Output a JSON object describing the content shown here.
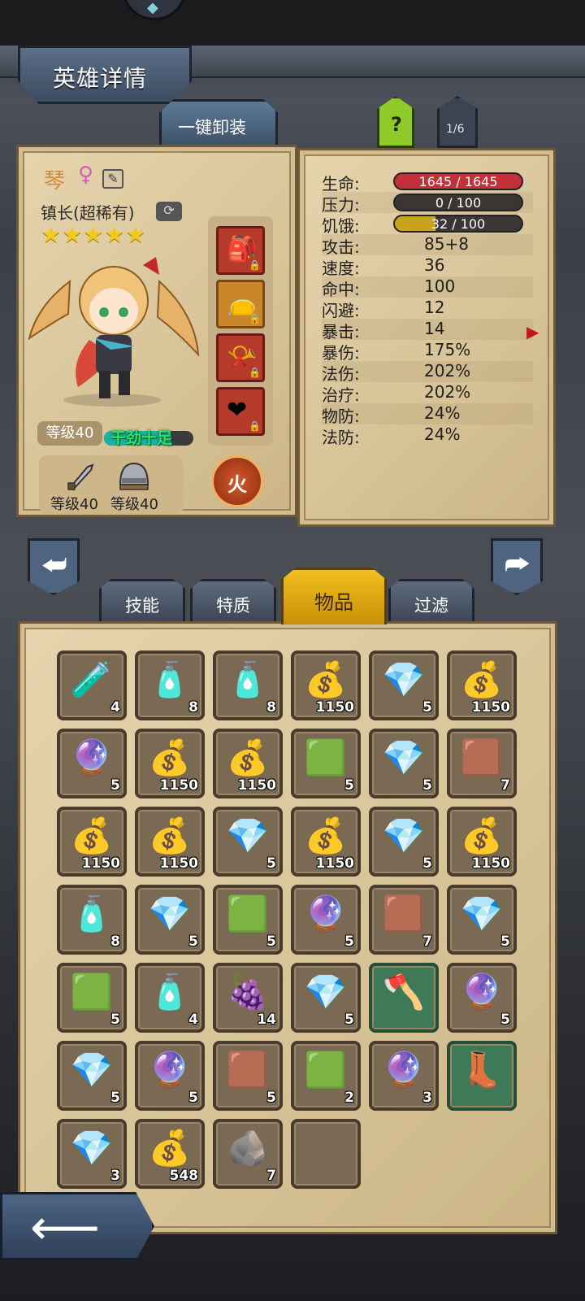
{
  "header": {
    "title": "英雄详情",
    "unequip_all": "一键卸装",
    "help": "?",
    "page": "1/6"
  },
  "hero": {
    "name": "琴",
    "gender_icon": "female-icon",
    "class": "镇长(超稀有)",
    "stars": "★★★★★",
    "level": "等级40",
    "mood": "干劲十足",
    "mood_fraction": 0.75,
    "weapon_level": "等级40",
    "armor_level": "等级40",
    "element": "火"
  },
  "stats": [
    {
      "key": "生命:",
      "value": "1645 / 1645",
      "bar": true,
      "fraction": 1.0,
      "color": "#c2303a"
    },
    {
      "key": "压力:",
      "value": "0 / 100",
      "bar": true,
      "fraction": 0.0,
      "color": "#8a8a8a"
    },
    {
      "key": "饥饿:",
      "value": "32 / 100",
      "bar": true,
      "fraction": 0.32,
      "color": "#c9a21e"
    },
    {
      "key": "攻击:",
      "value": "85+8"
    },
    {
      "key": "速度:",
      "value": "36"
    },
    {
      "key": "命中:",
      "value": "100"
    },
    {
      "key": "闪避:",
      "value": "12"
    },
    {
      "key": "暴击:",
      "value": "14"
    },
    {
      "key": "暴伤:",
      "value": "175%"
    },
    {
      "key": "法伤:",
      "value": "202%"
    },
    {
      "key": "治疗:",
      "value": "202%"
    },
    {
      "key": "物防:",
      "value": "24%"
    },
    {
      "key": "法防:",
      "value": "24%"
    }
  ],
  "tabs": [
    {
      "label": "技能",
      "active": false
    },
    {
      "label": "特质",
      "active": false
    },
    {
      "label": "物品",
      "active": true
    },
    {
      "label": "过滤",
      "active": false
    }
  ],
  "inventory": [
    {
      "icon": "red-potion-icon",
      "glyph": "🧪",
      "count": "4"
    },
    {
      "icon": "blue-potion-icon",
      "glyph": "🧴",
      "count": "8"
    },
    {
      "icon": "blue-potion-icon",
      "glyph": "🧴",
      "count": "8"
    },
    {
      "icon": "gold-bag-icon",
      "glyph": "💰",
      "count": "1150"
    },
    {
      "icon": "blue-gem-icon",
      "glyph": "💎",
      "count": "5"
    },
    {
      "icon": "gold-bag-icon",
      "glyph": "💰",
      "count": "1150"
    },
    {
      "icon": "purple-gem-icon",
      "glyph": "🔮",
      "count": "5"
    },
    {
      "icon": "gold-bag-icon",
      "glyph": "💰",
      "count": "1150"
    },
    {
      "icon": "gold-bag-icon",
      "glyph": "💰",
      "count": "1150"
    },
    {
      "icon": "green-crystal-icon",
      "glyph": "🟩",
      "count": "5"
    },
    {
      "icon": "blue-gem-icon",
      "glyph": "💎",
      "count": "5"
    },
    {
      "icon": "leather-scrap-icon",
      "glyph": "🟫",
      "count": "7"
    },
    {
      "icon": "gold-bag-icon",
      "glyph": "💰",
      "count": "1150"
    },
    {
      "icon": "gold-bag-icon",
      "glyph": "💰",
      "count": "1150"
    },
    {
      "icon": "blue-gem-icon",
      "glyph": "💎",
      "count": "5"
    },
    {
      "icon": "gold-bag-icon",
      "glyph": "💰",
      "count": "1150"
    },
    {
      "icon": "blue-gem-icon",
      "glyph": "💎",
      "count": "5"
    },
    {
      "icon": "gold-bag-icon",
      "glyph": "💰",
      "count": "1150"
    },
    {
      "icon": "blue-potion-icon",
      "glyph": "🧴",
      "count": "8"
    },
    {
      "icon": "blue-gem-icon",
      "glyph": "💎",
      "count": "5"
    },
    {
      "icon": "green-crystal-icon",
      "glyph": "🟩",
      "count": "5"
    },
    {
      "icon": "purple-gem-icon",
      "glyph": "🔮",
      "count": "5"
    },
    {
      "icon": "leather-scrap-icon",
      "glyph": "🟫",
      "count": "7"
    },
    {
      "icon": "blue-gem-icon",
      "glyph": "💎",
      "count": "5"
    },
    {
      "icon": "green-crystal-icon",
      "glyph": "🟩",
      "count": "5"
    },
    {
      "icon": "blue-potion-icon",
      "glyph": "🧴",
      "count": "4"
    },
    {
      "icon": "food-basket-icon",
      "glyph": "🍇",
      "count": "14"
    },
    {
      "icon": "blue-gem-icon",
      "glyph": "💎",
      "count": "5"
    },
    {
      "icon": "axe-icon",
      "glyph": "🪓",
      "count": "",
      "rare": true
    },
    {
      "icon": "purple-gem-icon",
      "glyph": "🔮",
      "count": "5"
    },
    {
      "icon": "blue-gem-icon",
      "glyph": "💎",
      "count": "5"
    },
    {
      "icon": "purple-gem-icon",
      "glyph": "🔮",
      "count": "5"
    },
    {
      "icon": "leather-scrap-icon",
      "glyph": "🟫",
      "count": "5"
    },
    {
      "icon": "green-crystal-icon",
      "glyph": "🟩",
      "count": "2"
    },
    {
      "icon": "purple-gem-icon",
      "glyph": "🔮",
      "count": "3"
    },
    {
      "icon": "winged-boots-icon",
      "glyph": "👢",
      "count": "",
      "rare": true
    },
    {
      "icon": "blue-gem-icon",
      "glyph": "💎",
      "count": "3"
    },
    {
      "icon": "gold-bag-icon",
      "glyph": "💰",
      "count": "548"
    },
    {
      "icon": "stone-ore-icon",
      "glyph": "🪨",
      "count": "7"
    },
    {
      "icon": "empty-slot",
      "glyph": "",
      "count": ""
    }
  ]
}
